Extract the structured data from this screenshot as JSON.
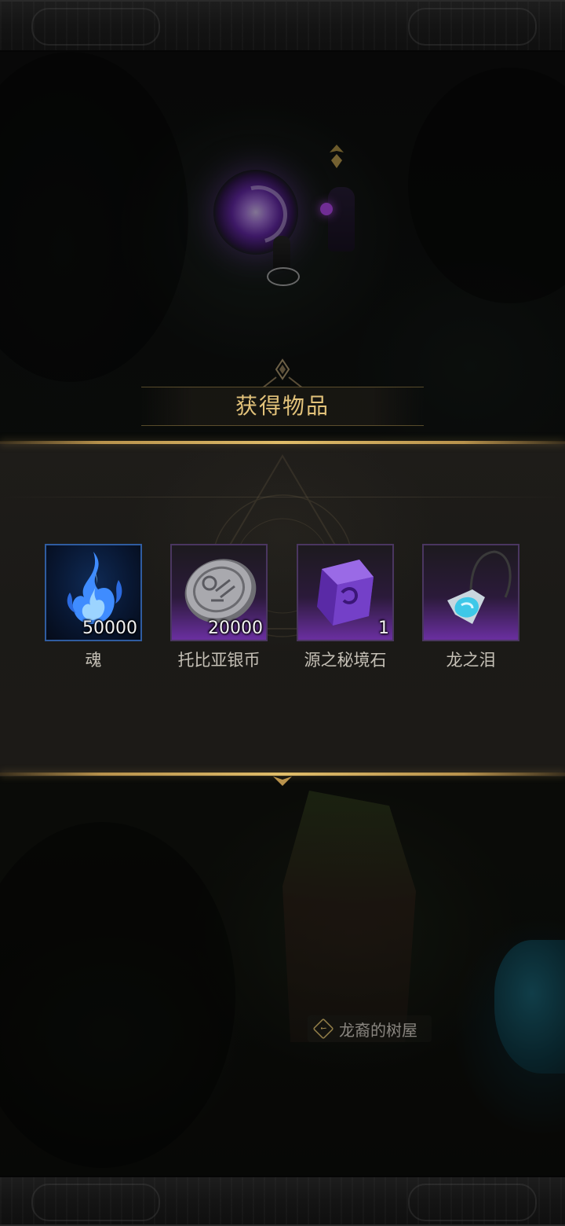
{
  "dialog": {
    "title": "获得物品"
  },
  "rewards": [
    {
      "name": "魂",
      "quantity": "50000",
      "icon": "blue-soul-flame-icon",
      "rarity_color": "#2f5ca0"
    },
    {
      "name": "托比亚银币",
      "quantity": "20000",
      "icon": "silver-coin-icon",
      "rarity_color": "#6a2fa0"
    },
    {
      "name": "源之秘境石",
      "quantity": "1",
      "icon": "purple-crystal-stone-icon",
      "rarity_color": "#6a2fa0"
    },
    {
      "name": "龙之泪",
      "quantity": "",
      "icon": "dragon-tear-pendant-icon",
      "rarity_color": "#6a2fa0"
    }
  ],
  "location": {
    "name": "龙裔的树屋",
    "icon": "location-check-icon"
  },
  "colors": {
    "gold_accent": "#e0bd6a",
    "title_text": "#e2c27a",
    "panel_bg": "#1c1a17"
  }
}
